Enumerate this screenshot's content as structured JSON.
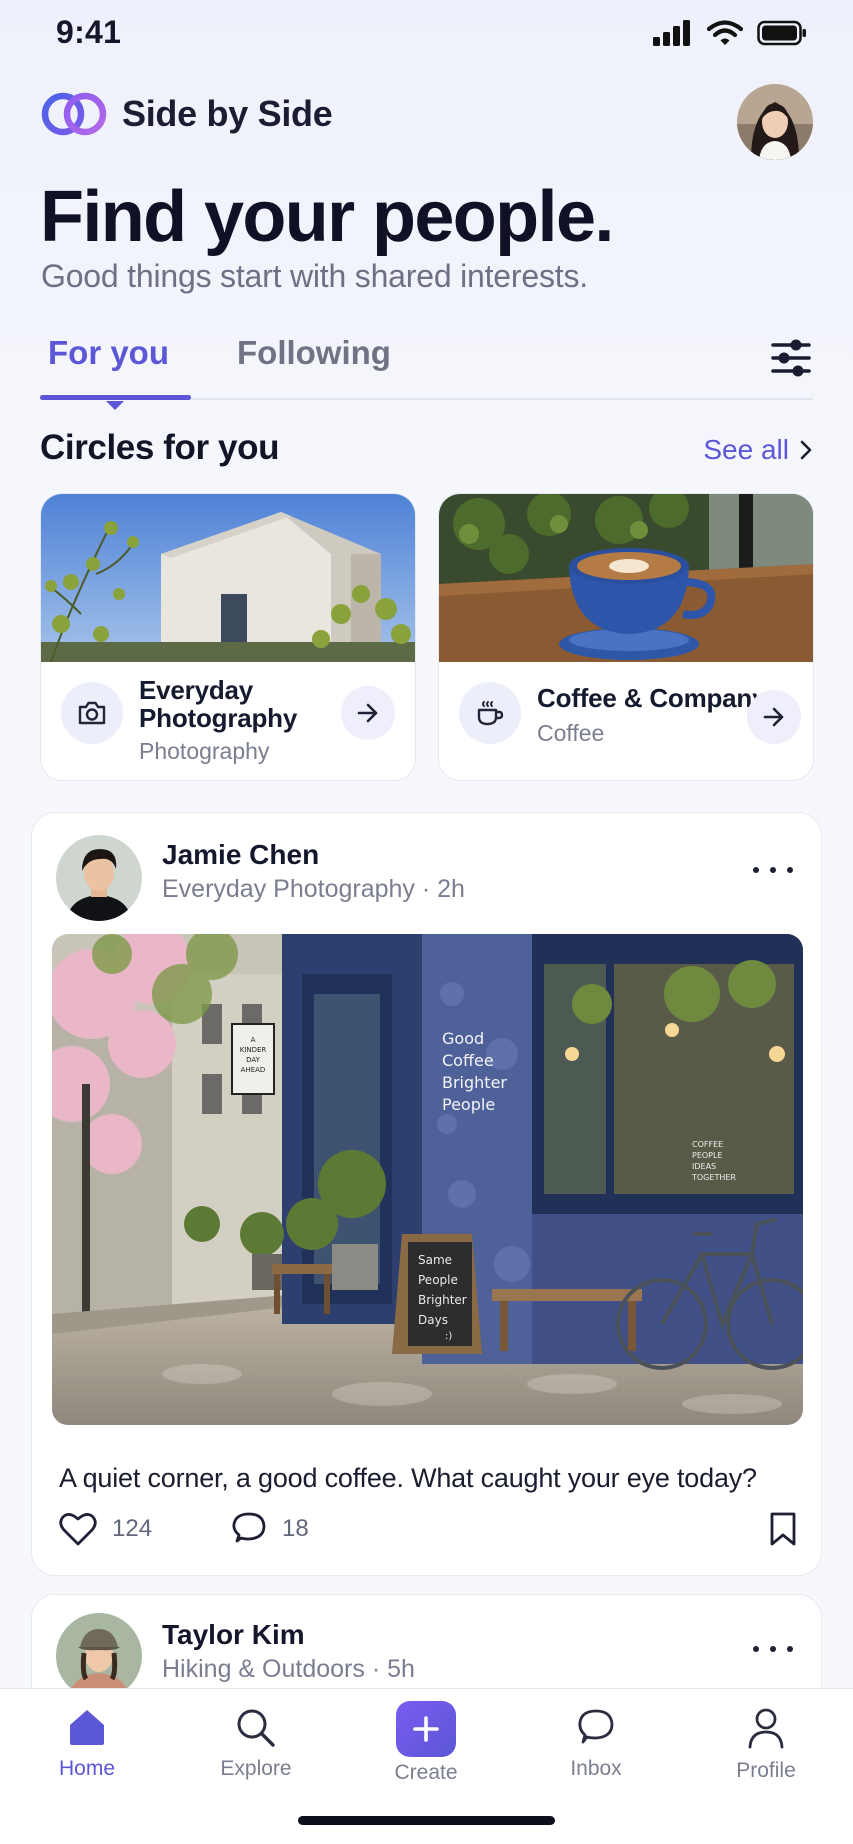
{
  "status_bar": {
    "time": "9:41"
  },
  "brand": {
    "name": "Side by Side"
  },
  "hero": {
    "title": "Find your people.",
    "subtitle": "Good things start with shared interests."
  },
  "tabs": [
    {
      "label": "For you",
      "active": true
    },
    {
      "label": "Following",
      "active": false
    }
  ],
  "circles_section": {
    "title": "Circles for you",
    "see_all": "See all",
    "circles": [
      {
        "name_line1": "Everyday",
        "name_line2": "Photography",
        "category": "Photography",
        "icon": "camera-icon"
      },
      {
        "name": "Coffee & Company",
        "category": "Coffee",
        "icon": "coffee-cup-icon"
      }
    ]
  },
  "posts": [
    {
      "author": "Jamie Chen",
      "meta": "Everyday Photography · 2h",
      "image_text": {
        "wall_sign": [
          "Good",
          "Coffee",
          "Brighter",
          "People"
        ],
        "chalkboard": [
          "Same",
          "People",
          "Brighter",
          "Days",
          ":)"
        ],
        "street_sign": [
          "A",
          "KINDER",
          "DAY",
          "AHEAD"
        ],
        "window_sign": [
          "COFFEE",
          "PEOPLE",
          "IDEAS",
          "TOGETHER"
        ]
      },
      "caption": "A quiet corner, a good coffee. What caught your eye today?",
      "likes": "124",
      "comments": "18"
    },
    {
      "author": "Taylor Kim",
      "meta": "Hiking & Outdoors · 5h"
    }
  ],
  "bottom_nav": [
    {
      "label": "Home",
      "icon": "home-icon",
      "active": true
    },
    {
      "label": "Explore",
      "icon": "search-icon",
      "active": false
    },
    {
      "label": "Create",
      "icon": "plus-icon",
      "active": false
    },
    {
      "label": "Inbox",
      "icon": "chat-icon",
      "active": false
    },
    {
      "label": "Profile",
      "icon": "person-icon",
      "active": false
    }
  ],
  "colors": {
    "accent": "#5b57d6",
    "text_primary": "#14172b",
    "text_secondary": "#7a7e90",
    "background": "#f4f6fc"
  }
}
